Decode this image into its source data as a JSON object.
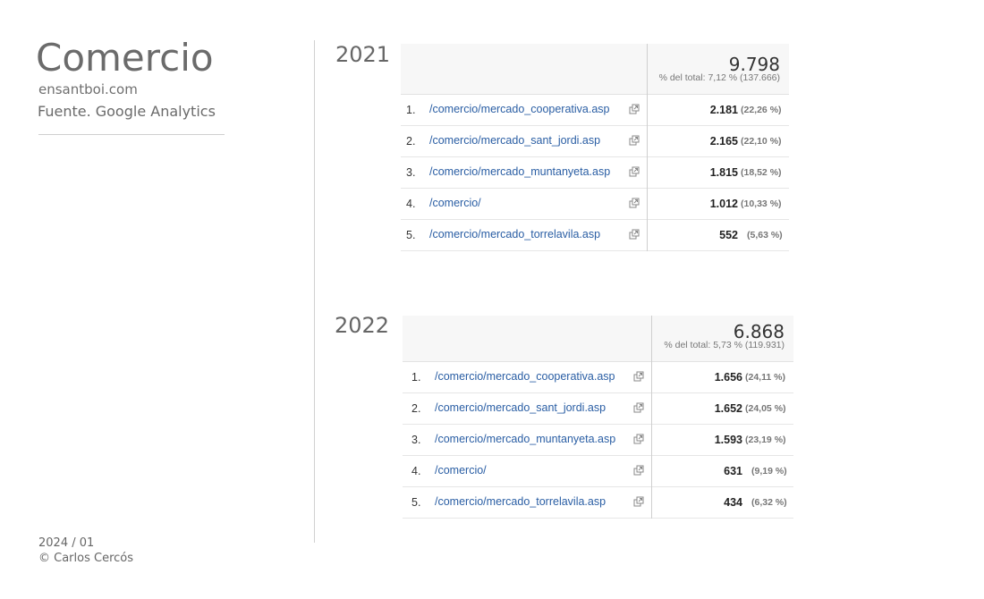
{
  "header": {
    "title": "Comercio",
    "site": "ensantboi.com",
    "source": "Fuente. Google Analytics"
  },
  "footer": {
    "date": "2024 / 01",
    "copyright": "© Carlos Cercós"
  },
  "tables": [
    {
      "year": "2021",
      "total": "9.798",
      "total_pct": "% del total: 7,12 % (137.666)",
      "rows": [
        {
          "rank": "1.",
          "page": "/comercio/mercado_cooperativa.asp",
          "value": "2.181",
          "share": "(22,26 %)"
        },
        {
          "rank": "2.",
          "page": "/comercio/mercado_sant_jordi.asp",
          "value": "2.165",
          "share": "(22,10 %)"
        },
        {
          "rank": "3.",
          "page": "/comercio/mercado_muntanyeta.asp",
          "value": "1.815",
          "share": "(18,52 %)"
        },
        {
          "rank": "4.",
          "page": "/comercio/",
          "value": "1.012",
          "share": "(10,33 %)"
        },
        {
          "rank": "5.",
          "page": "/comercio/mercado_torrelavila.asp",
          "value": "552",
          "share": "(5,63 %)"
        }
      ]
    },
    {
      "year": "2022",
      "total": "6.868",
      "total_pct": "% del total: 5,73 % (119.931)",
      "rows": [
        {
          "rank": "1.",
          "page": "/comercio/mercado_cooperativa.asp",
          "value": "1.656",
          "share": "(24,11 %)"
        },
        {
          "rank": "2.",
          "page": "/comercio/mercado_sant_jordi.asp",
          "value": "1.652",
          "share": "(24,05 %)"
        },
        {
          "rank": "3.",
          "page": "/comercio/mercado_muntanyeta.asp",
          "value": "1.593",
          "share": "(23,19 %)"
        },
        {
          "rank": "4.",
          "page": "/comercio/",
          "value": "631",
          "share": "(9,19 %)"
        },
        {
          "rank": "5.",
          "page": "/comercio/mercado_torrelavila.asp",
          "value": "434",
          "share": "(6,32 %)"
        }
      ]
    }
  ],
  "icons": {
    "row_link": "external-link-icon"
  },
  "colors": {
    "link": "#2a5ea4",
    "text": "#333333",
    "muted": "#777777"
  }
}
